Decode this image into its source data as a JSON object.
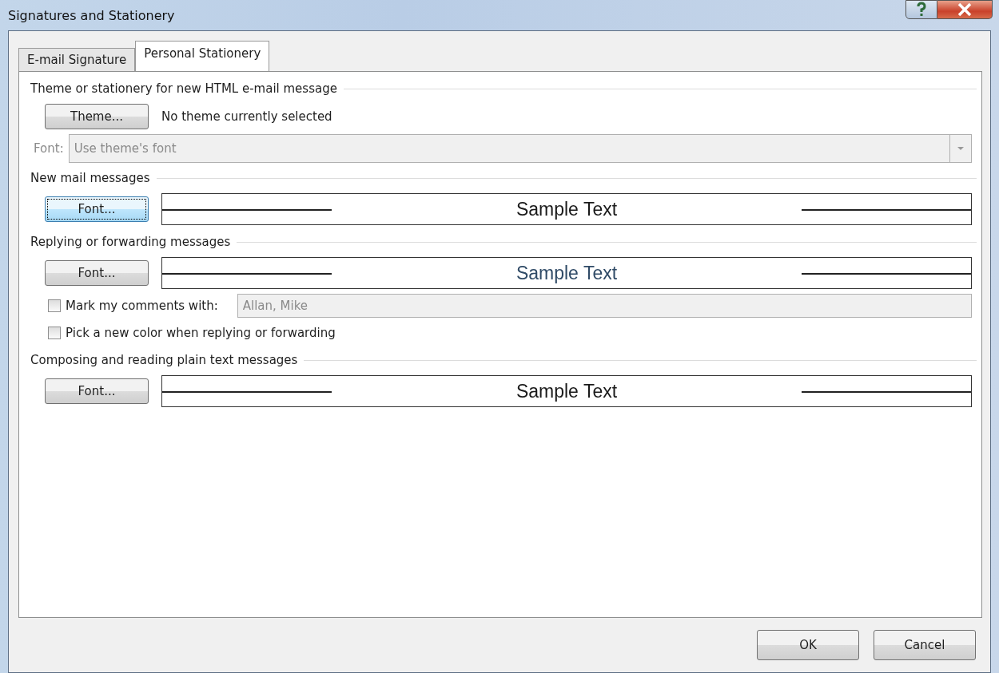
{
  "window": {
    "title": "Signatures and Stationery"
  },
  "tabs": [
    {
      "label": "E-mail Signature",
      "selected": false
    },
    {
      "label": "Personal Stationery",
      "selected": true
    }
  ],
  "theme_section": {
    "heading": "Theme or stationery for new HTML e-mail message",
    "button": {
      "label": "Theme..."
    },
    "status": "No theme currently selected",
    "font_label": "Font:",
    "font_value": "Use theme's font",
    "font_disabled": true
  },
  "sections": [
    {
      "heading": "New mail messages",
      "button": {
        "label": "Font...",
        "focused": true
      },
      "sample": "Sample Text",
      "color": "#1a1a1a"
    },
    {
      "heading": "Replying or forwarding messages",
      "button": {
        "label": "Font...",
        "focused": false
      },
      "sample": "Sample Text",
      "color": "#2f4a66",
      "options": [
        {
          "kind": "field",
          "label": "Mark my comments with:",
          "checked": false,
          "value": "Allan, Mike",
          "disabled": true
        },
        {
          "kind": "check",
          "label": "Pick a new color when replying or forwarding",
          "checked": false
        }
      ]
    },
    {
      "heading": "Composing and reading plain text messages",
      "button": {
        "label": "Font...",
        "focused": false
      },
      "sample": "Sample Text",
      "color": "#1a1a1a"
    }
  ],
  "buttons": [
    {
      "label": "OK"
    },
    {
      "label": "Cancel"
    }
  ]
}
